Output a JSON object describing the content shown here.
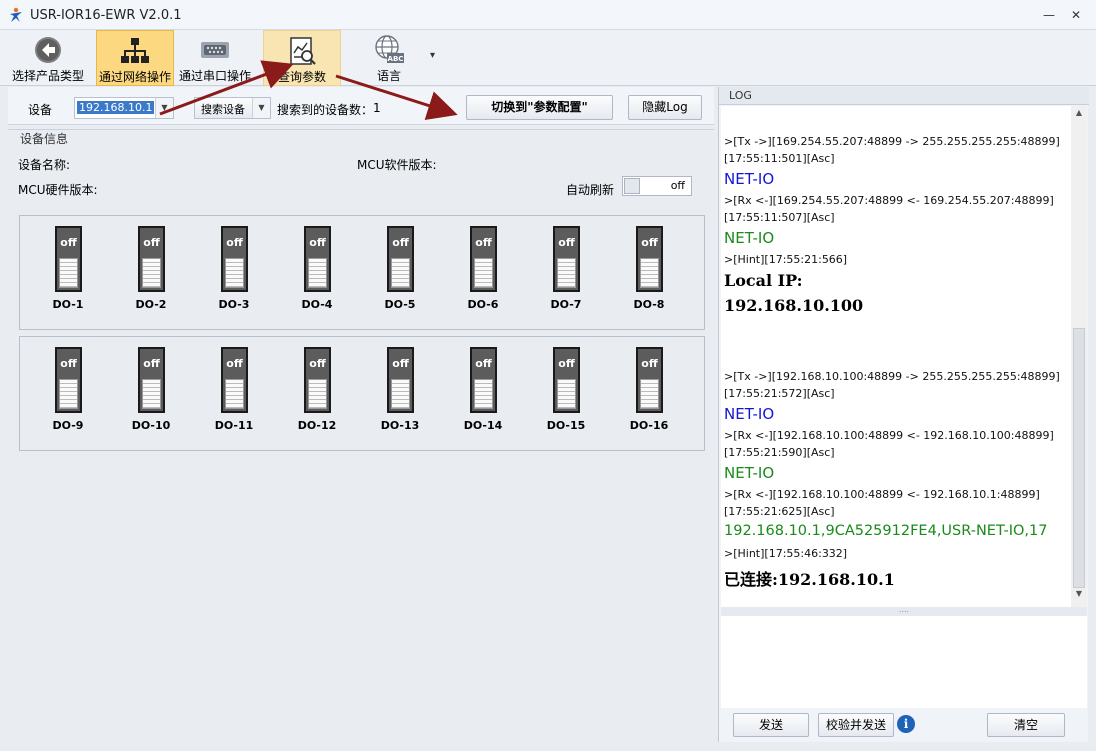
{
  "window": {
    "title": "USR-IOR16-EWR V2.0.1",
    "minimize": "—",
    "close": "✕"
  },
  "ribbon": {
    "items": [
      {
        "label": "选择产品类型",
        "icon": "back-arrow-icon"
      },
      {
        "label": "通过网络操作",
        "icon": "network-icon"
      },
      {
        "label": "通过串口操作",
        "icon": "serial-port-icon"
      },
      {
        "label": "查询参数",
        "icon": "query-params-icon"
      },
      {
        "label": "语言",
        "icon": "language-globe-icon"
      }
    ],
    "dropdown": "▾"
  },
  "devicebar": {
    "device_label": "设备",
    "device_value": "192.168.10.1",
    "search_button": "搜索设备",
    "found_label": "搜索到的设备数：",
    "found_count": "1",
    "switch_button": "切换到\"参数配置\"",
    "hide_log_button": "隐藏Log"
  },
  "device_info": {
    "group_title": "设备信息",
    "name_label": "设备名称:",
    "mcu_sw_label": "MCU软件版本:",
    "mcu_hw_label": "MCU硬件版本:",
    "auto_refresh_label": "自动刷新",
    "auto_refresh_state": "off"
  },
  "outputs": {
    "state_text": "off",
    "row1": [
      "DO-1",
      "DO-2",
      "DO-3",
      "DO-4",
      "DO-5",
      "DO-6",
      "DO-7",
      "DO-8"
    ],
    "row2": [
      "DO-9",
      "DO-10",
      "DO-11",
      "DO-12",
      "DO-13",
      "DO-14",
      "DO-15",
      "DO-16"
    ]
  },
  "log": {
    "header": "LOG",
    "lines": [
      "&gt;[Tx -&gt;][169.254.55.207:48899 -&gt; 255.255.255.255:48899]",
      "[17:55:11:501][Asc]",
      "NET-IO",
      "&gt;[Rx &lt;-][169.254.55.207:48899 &lt;- 169.254.55.207:48899]",
      "[17:55:11:507][Asc]",
      "NET-IO",
      "&gt;[Hint][17:55:21:566]",
      "Local IP:",
      "192.168.10.100",
      "&gt;[Tx -&gt;][192.168.10.100:48899 -&gt; 255.255.255.255:48899]",
      "[17:55:21:572][Asc]",
      "NET-IO",
      "&gt;[Rx &lt;-][192.168.10.100:48899 &lt;- 192.168.10.100:48899]",
      "[17:55:21:590][Asc]",
      "NET-IO",
      "&gt;[Rx &lt;-][192.168.10.100:48899 &lt;- 192.168.10.1:48899]",
      "[17:55:21:625][Asc]",
      "192.168.10.1,9CA525912FE4,USR-NET-IO,17",
      "&gt;[Hint][17:55:46:332]",
      "已连接:192.168.10.1"
    ],
    "send_button": "发送",
    "verify_send_button": "校验并发送",
    "info_icon": "i",
    "clear_button": "清空"
  },
  "colors": {
    "ribbon_active": "#fcd980",
    "log_blue": "#1414d8",
    "log_green": "#1a8a1a",
    "arrow": "#8b1a1a"
  }
}
